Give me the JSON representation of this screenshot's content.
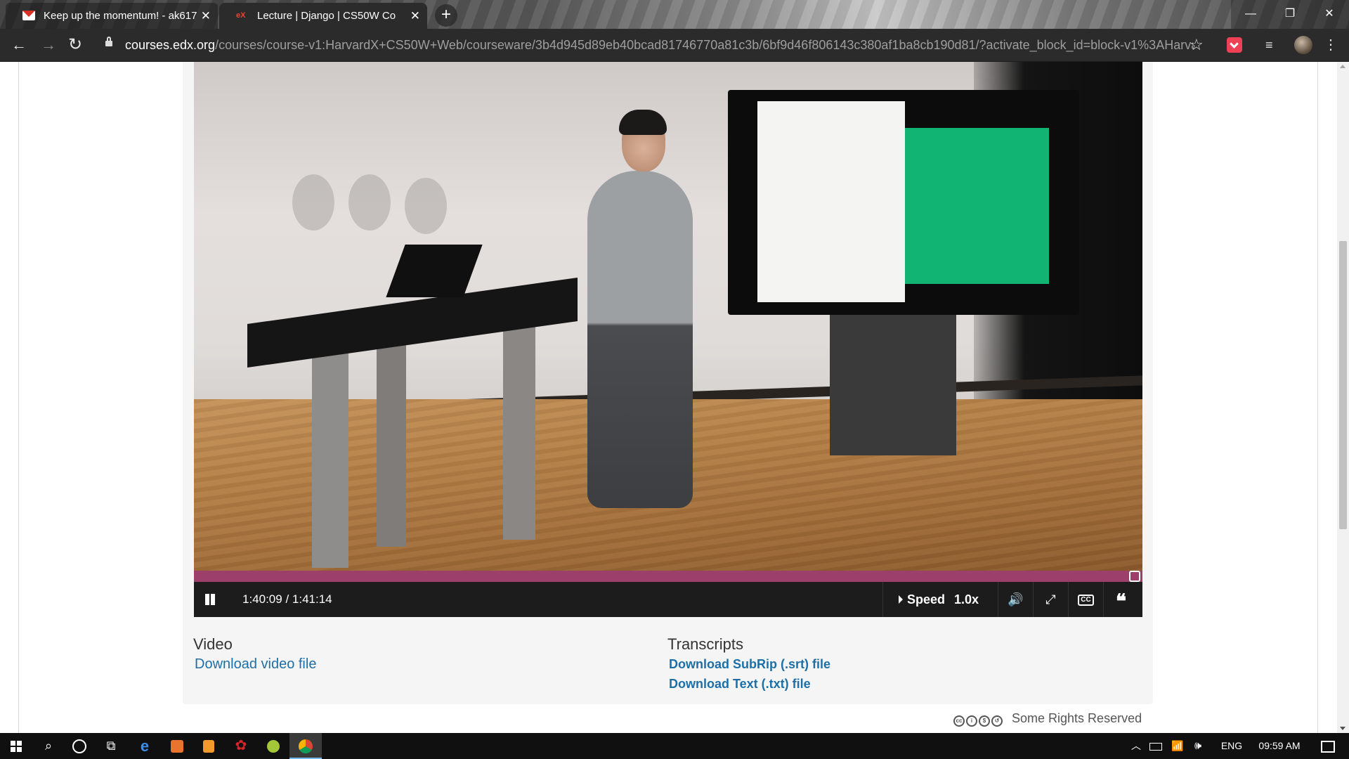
{
  "browser": {
    "tabs": [
      {
        "title": "Keep up the momentum! - ak617",
        "favicon": "gmail-icon",
        "active": false
      },
      {
        "title": "Lecture | Django | CS50W Co",
        "favicon": "edx-icon",
        "active": true
      }
    ],
    "new_tab_icon": "+",
    "window_controls": {
      "minimize": "—",
      "restore": "❐",
      "close": "✕"
    },
    "nav_icons": {
      "back": "←",
      "forward": "→",
      "reload": "↻",
      "star": "☆",
      "media": "≡",
      "menu": "⋮"
    },
    "url_domain": "courses.edx.org",
    "url_path": "/courses/course-v1:HarvardX+CS50W+Web/courseware/3b4d945d89eb40bcad81746770a81c3b/6bf9d46f806143c380af1ba8cb190d81/?activate_block_id=block-v1%3AHarvard..."
  },
  "video": {
    "progress_fraction": 0.9917,
    "time_display": "1:40:09 / 1:41:14",
    "speed_label": "Speed",
    "speed_value": "1.0x",
    "icons": {
      "volume": "🔊",
      "fullscreen": "⤢",
      "cc": "CC",
      "transcript": "❝"
    }
  },
  "downloads": {
    "video_heading": "Video",
    "video_link": "Download video file",
    "transcripts_heading": "Transcripts",
    "srt_link": "Download SubRip (.srt) file",
    "txt_link": "Download Text (.txt) file"
  },
  "license": {
    "text": "Some Rights Reserved",
    "icons": [
      "cc",
      "by",
      "nc",
      "sa"
    ]
  },
  "taskbar": {
    "icons": {
      "search": "⌕",
      "taskview": "⧉",
      "edge": "e",
      "app_red": "✿",
      "chevron": "︿",
      "wifi": "📶",
      "volume": "🕪"
    },
    "language": "ENG",
    "time": "09:59 AM"
  },
  "colors": {
    "progress": "#9c3f6a",
    "link": "#1d6fa8",
    "control_bar": "#1c1c1c",
    "browser_chrome": "#2b2b2b"
  }
}
